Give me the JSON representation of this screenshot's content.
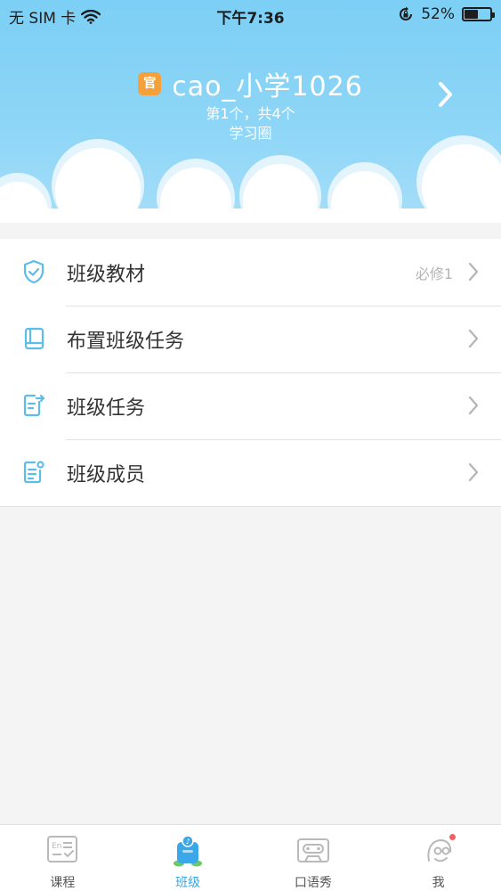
{
  "status_bar": {
    "carrier": "无 SIM 卡",
    "time": "下午7:36",
    "battery_percent": "52%",
    "battery_level": 0.52,
    "icons": [
      "wifi-icon",
      "orientation-lock-icon",
      "battery-icon"
    ]
  },
  "header": {
    "badge": "官",
    "class_name": "cao_小学1026",
    "position_text": "第1个，共4个",
    "circle_label": "学习圈"
  },
  "menu": {
    "items": [
      {
        "label": "班级教材",
        "badge": "必修1",
        "icon": "shield-check-icon"
      },
      {
        "label": "布置班级任务",
        "badge": "",
        "icon": "book-icon"
      },
      {
        "label": "班级任务",
        "badge": "",
        "icon": "task-share-icon"
      },
      {
        "label": "班级成员",
        "badge": "",
        "icon": "member-list-icon"
      }
    ]
  },
  "tabs": [
    {
      "label": "课程",
      "icon": "course-icon",
      "active": false
    },
    {
      "label": "班级",
      "icon": "class-icon",
      "active": true
    },
    {
      "label": "口语秀",
      "icon": "cassette-icon",
      "active": false
    },
    {
      "label": "我",
      "icon": "profile-icon",
      "active": false,
      "notification_dot": true
    }
  ],
  "colors": {
    "header_top": "#7ccff5",
    "accent_blue": "#3aa7e8",
    "icon_blue": "#5bbde9",
    "badge_orange": "#f4a13b",
    "notification_red": "#f26060"
  }
}
